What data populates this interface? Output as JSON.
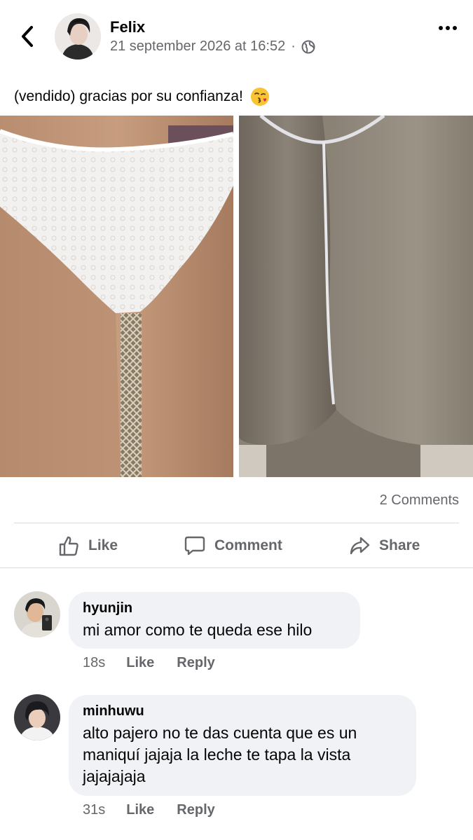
{
  "post": {
    "author": "Felix",
    "timestamp": "21 september 2026 at 16:52",
    "separator": "·",
    "privacy_icon": "globe-icon",
    "text": "(vendido) gracias por su confianza!",
    "emoji": "face-blowing-kiss",
    "image_alt": "photo collage of two underwear images",
    "comments_count": "2 Comments"
  },
  "actions": {
    "like": "Like",
    "comment": "Comment",
    "share": "Share"
  },
  "comments": [
    {
      "author": "hyunjin",
      "text": "mi amor como te queda ese hilo",
      "time": "18s",
      "like": "Like",
      "reply": "Reply"
    },
    {
      "author": "minhuwu",
      "text": "alto pajero no te das cuenta que es un maniquí jajaja la leche te tapa la vista jajajajaja",
      "time": "31s",
      "like": "Like",
      "reply": "Reply"
    }
  ],
  "colors": {
    "text": "#050505",
    "secondary": "#65676b",
    "bubble": "#f0f2f5",
    "divider": "#d9dadd"
  }
}
